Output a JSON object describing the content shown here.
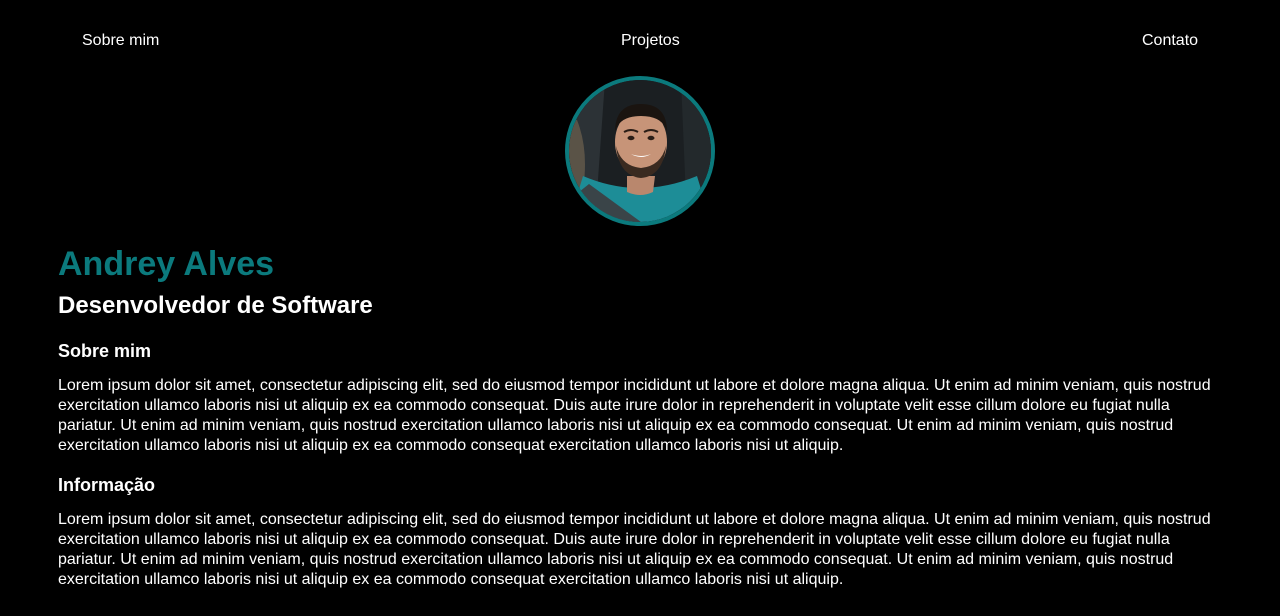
{
  "nav": {
    "items": [
      {
        "label": "Sobre mim"
      },
      {
        "label": "Projetos"
      },
      {
        "label": "Contato"
      }
    ]
  },
  "profile": {
    "photo_alt": "Andrey Alves",
    "accent_color": "#0b7a7d"
  },
  "header": {
    "name": "Andrey Alves",
    "role": "Desenvolvedor de Software"
  },
  "sections": [
    {
      "title": "Sobre mim",
      "text": "Lorem ipsum dolor sit amet, consectetur adipiscing elit, sed do eiusmod tempor incididunt ut labore et dolore magna aliqua. Ut enim ad minim veniam, quis nostrud exercitation ullamco laboris nisi ut aliquip ex ea commodo consequat. Duis aute irure dolor in reprehenderit in voluptate velit esse cillum dolore eu fugiat nulla pariatur. Ut enim ad minim veniam, quis nostrud exercitation ullamco laboris nisi ut aliquip ex ea commodo consequat. Ut enim ad minim veniam, quis nostrud exercitation ullamco laboris nisi ut aliquip ex ea commodo consequat exercitation ullamco laboris nisi ut aliquip."
    },
    {
      "title": "Informação",
      "text": "Lorem ipsum dolor sit amet, consectetur adipiscing elit, sed do eiusmod tempor incididunt ut labore et dolore magna aliqua. Ut enim ad minim veniam, quis nostrud exercitation ullamco laboris nisi ut aliquip ex ea commodo consequat. Duis aute irure dolor in reprehenderit in voluptate velit esse cillum dolore eu fugiat nulla pariatur. Ut enim ad minim veniam, quis nostrud exercitation ullamco laboris nisi ut aliquip ex ea commodo consequat. Ut enim ad minim veniam, quis nostrud exercitation ullamco laboris nisi ut aliquip ex ea commodo consequat exercitation ullamco laboris nisi ut aliquip."
    }
  ]
}
